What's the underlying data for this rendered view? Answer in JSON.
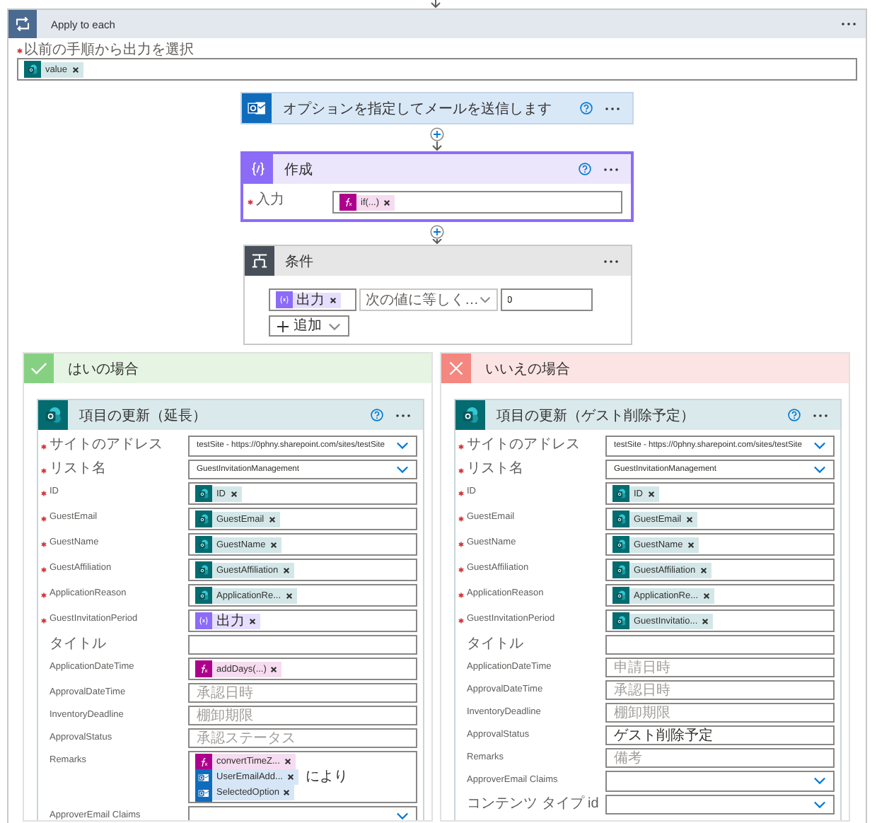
{
  "scope": {
    "title": "Apply to each",
    "label": "以前の手順から出力を選択",
    "required": true,
    "tokens": [
      {
        "kind": "sharepoint",
        "text": "value"
      }
    ]
  },
  "actions": [
    {
      "kind": "outlook",
      "title": "オプションを指定してメールを送信します"
    },
    {
      "kind": "compose",
      "title": "作成",
      "fields": [
        {
          "label": "入力",
          "required": true,
          "kind": "input",
          "tokens": [
            {
              "kind": "expression",
              "text": "if(...)"
            }
          ]
        }
      ]
    }
  ],
  "condition": {
    "kind": "condition",
    "title": "条件",
    "tokens": [
      {
        "kind": "variable",
        "text": "出力"
      }
    ],
    "operator": "次の値に等しく…",
    "value": "0",
    "add_button": "追加"
  },
  "branches": [
    {
      "kind": "yes",
      "title": "はいの場合",
      "action": {
        "kind": "sharepoint",
        "title": "項目の更新（延長）",
        "fields": [
          {
            "label": "サイトのアドレス",
            "required": true,
            "kind": "dropdown",
            "value": "testSite - https://0phny.sharepoint.com/sites/testSite"
          },
          {
            "label": "リスト名",
            "required": true,
            "kind": "dropdown",
            "value": "GuestInvitationManagement"
          },
          {
            "label": "ID",
            "required": true,
            "kind": "input",
            "tokens": [
              {
                "kind": "sharepoint",
                "text": "ID"
              }
            ]
          },
          {
            "label": "GuestEmail",
            "required": true,
            "kind": "input",
            "tokens": [
              {
                "kind": "sharepoint",
                "text": "GuestEmail"
              }
            ]
          },
          {
            "label": "GuestName",
            "required": true,
            "kind": "input",
            "tokens": [
              {
                "kind": "sharepoint",
                "text": "GuestName"
              }
            ]
          },
          {
            "label": "GuestAffiliation",
            "required": true,
            "kind": "input",
            "tokens": [
              {
                "kind": "sharepoint",
                "text": "GuestAffiliation"
              }
            ]
          },
          {
            "label": "ApplicationReason",
            "required": true,
            "kind": "input",
            "tokens": [
              {
                "kind": "sharepoint",
                "text": "ApplicationRe..."
              }
            ]
          },
          {
            "label": "GuestInvitationPeriod",
            "required": true,
            "kind": "input",
            "tokens": [
              {
                "kind": "variable",
                "text": "出力"
              }
            ]
          },
          {
            "label": "タイトル",
            "required": false,
            "kind": "input"
          },
          {
            "label": "ApplicationDateTime",
            "required": false,
            "kind": "input",
            "tokens": [
              {
                "kind": "expression",
                "text": "addDays(...)"
              }
            ]
          },
          {
            "label": "ApprovalDateTime",
            "required": false,
            "kind": "input",
            "placeholder": "承認日時"
          },
          {
            "label": "InventoryDeadline",
            "required": false,
            "kind": "input",
            "placeholder": "棚卸期限"
          },
          {
            "label": "ApprovalStatus",
            "required": false,
            "kind": "input",
            "placeholder": "承認ステータス"
          },
          {
            "label": "Remarks",
            "required": false,
            "kind": "input",
            "tokens": [
              {
                "kind": "expression",
                "text": "convertTimeZ..."
              },
              {
                "kind": "outlook",
                "text": "UserEmailAdd..."
              },
              {
                "kind": "text",
                "text": "により"
              },
              {
                "kind": "outlook",
                "text": "SelectedOption"
              }
            ]
          },
          {
            "label": "ApproverEmail Claims",
            "required": false,
            "kind": "dropdown"
          }
        ]
      }
    },
    {
      "kind": "no",
      "title": "いいえの場合",
      "action": {
        "kind": "sharepoint",
        "title": "項目の更新（ゲスト削除予定）",
        "fields": [
          {
            "label": "サイトのアドレス",
            "required": true,
            "kind": "dropdown",
            "value": "testSite - https://0phny.sharepoint.com/sites/testSite"
          },
          {
            "label": "リスト名",
            "required": true,
            "kind": "dropdown",
            "value": "GuestInvitationManagement"
          },
          {
            "label": "ID",
            "required": true,
            "kind": "input",
            "tokens": [
              {
                "kind": "sharepoint",
                "text": "ID"
              }
            ]
          },
          {
            "label": "GuestEmail",
            "required": true,
            "kind": "input",
            "tokens": [
              {
                "kind": "sharepoint",
                "text": "GuestEmail"
              }
            ]
          },
          {
            "label": "GuestName",
            "required": true,
            "kind": "input",
            "tokens": [
              {
                "kind": "sharepoint",
                "text": "GuestName"
              }
            ]
          },
          {
            "label": "GuestAffiliation",
            "required": true,
            "kind": "input",
            "tokens": [
              {
                "kind": "sharepoint",
                "text": "GuestAffiliation"
              }
            ]
          },
          {
            "label": "ApplicationReason",
            "required": true,
            "kind": "input",
            "tokens": [
              {
                "kind": "sharepoint",
                "text": "ApplicationRe..."
              }
            ]
          },
          {
            "label": "GuestInvitationPeriod",
            "required": true,
            "kind": "input",
            "tokens": [
              {
                "kind": "sharepoint",
                "text": "GuestInvitatio..."
              }
            ]
          },
          {
            "label": "タイトル",
            "required": false,
            "kind": "input"
          },
          {
            "label": "ApplicationDateTime",
            "required": false,
            "kind": "input",
            "placeholder": "申請日時"
          },
          {
            "label": "ApprovalDateTime",
            "required": false,
            "kind": "input",
            "placeholder": "承認日時"
          },
          {
            "label": "InventoryDeadline",
            "required": false,
            "kind": "input",
            "placeholder": "棚卸期限"
          },
          {
            "label": "ApprovalStatus",
            "required": false,
            "kind": "input",
            "value": "ゲスト削除予定"
          },
          {
            "label": "Remarks",
            "required": false,
            "kind": "input",
            "placeholder": "備考"
          },
          {
            "label": "ApproverEmail Claims",
            "required": false,
            "kind": "dropdown"
          },
          {
            "label": "コンテンツ タイプ id",
            "required": false,
            "kind": "dropdown"
          }
        ]
      }
    }
  ]
}
